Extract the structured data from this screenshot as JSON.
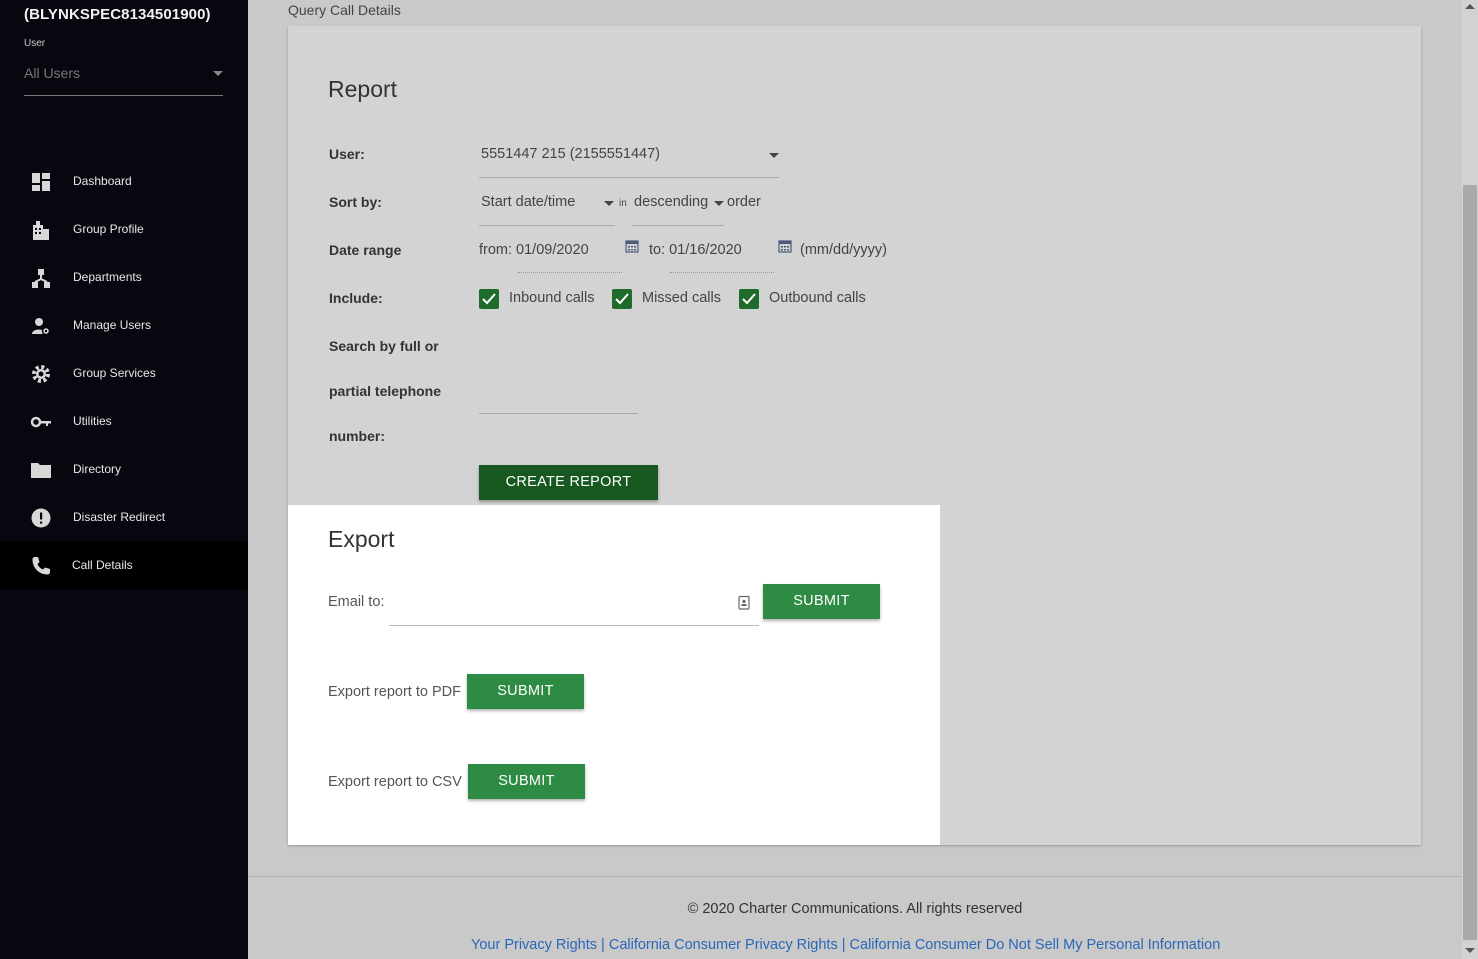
{
  "sidebar": {
    "group_id": "(BLYNKSPEC8134501900)",
    "user_label": "User",
    "user_value": "All Users",
    "items": [
      {
        "label": "Dashboard",
        "icon": "dashboard-icon"
      },
      {
        "label": "Group Profile",
        "icon": "building-icon"
      },
      {
        "label": "Departments",
        "icon": "hierarchy-icon"
      },
      {
        "label": "Manage Users",
        "icon": "user-gear-icon"
      },
      {
        "label": "Group Services",
        "icon": "gear-icon"
      },
      {
        "label": "Utilities",
        "icon": "key-icon"
      },
      {
        "label": "Directory",
        "icon": "folder-icon"
      },
      {
        "label": "Disaster Redirect",
        "icon": "alert-icon"
      },
      {
        "label": "Call Details",
        "icon": "phone-icon",
        "active": true
      }
    ]
  },
  "breadcrumb": "Query Call Details",
  "report": {
    "title": "Report",
    "user_label": "User:",
    "user_value": "5551447 215 (2155551447)",
    "sort_label": "Sort by:",
    "sort_value": "Start date/time",
    "in_text": "in",
    "order_value": "descending",
    "order_text": "order",
    "date_label": "Date range",
    "from_text": "from: 01/09/2020",
    "to_text": "to: 01/16/2020",
    "date_format": "(mm/dd/yyyy)",
    "include_label": "Include:",
    "include_options": [
      "Inbound calls",
      "Missed calls",
      "Outbound calls"
    ],
    "search_label_1": "Search by full or",
    "search_label_2": "partial telephone",
    "search_label_3": "number:",
    "search_value": "",
    "create_button": "CREATE REPORT"
  },
  "export": {
    "title": "Export",
    "email_label": "Email to:",
    "email_value": "",
    "email_submit": "SUBMIT",
    "pdf_label": "Export report to PDF",
    "pdf_submit": "SUBMIT",
    "csv_label": "Export report to CSV",
    "csv_submit": "SUBMIT"
  },
  "footer": {
    "copyright": "© 2020 Charter Communications. All rights reserved",
    "link_1": "Your Privacy Rights",
    "link_2": "California Consumer Privacy Rights",
    "link_3": "California Consumer Do Not Sell My Personal Information",
    "separator": "|"
  },
  "colors": {
    "sidebar_bg": "#07070f",
    "primary_green": "#16581f",
    "accent_green": "#2e8b43",
    "link_blue": "#2a67b8"
  }
}
